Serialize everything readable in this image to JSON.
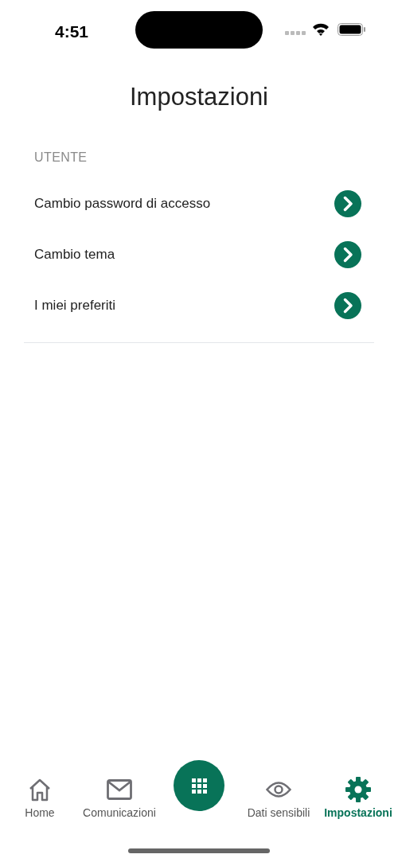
{
  "status_bar": {
    "time": "4:51"
  },
  "title": "Impostazioni",
  "section": {
    "header": "UTENTE",
    "items": [
      {
        "label": "Cambio password di accesso"
      },
      {
        "label": "Cambio tema"
      },
      {
        "label": "I miei preferiti"
      }
    ]
  },
  "tab_bar": [
    {
      "kind": "home",
      "label": "Home",
      "selected": false
    },
    {
      "kind": "mail",
      "label": "Comunicazioni",
      "selected": false
    },
    {
      "kind": "grid",
      "selected": false
    },
    {
      "kind": "eye",
      "label": "Dati sensibili",
      "selected": false
    },
    {
      "kind": "gear",
      "label": "Impostazioni",
      "selected": true
    }
  ]
}
